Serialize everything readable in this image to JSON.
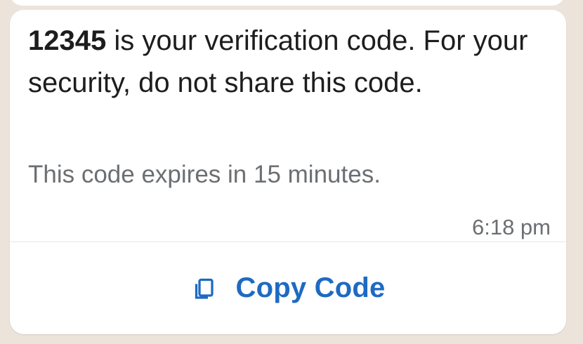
{
  "message": {
    "code": "12345",
    "body_rest": " is your verification code. For your security, do not share this code.",
    "footer": "This code expires in 15 minutes.",
    "time": "6:18 pm"
  },
  "action": {
    "label": "Copy Code",
    "icon": "copy-icon"
  },
  "colors": {
    "accent": "#1e6ac3",
    "bubble": "#ffffff",
    "wallpaper": "#ece4da",
    "muted_text": "#6c6f72"
  }
}
